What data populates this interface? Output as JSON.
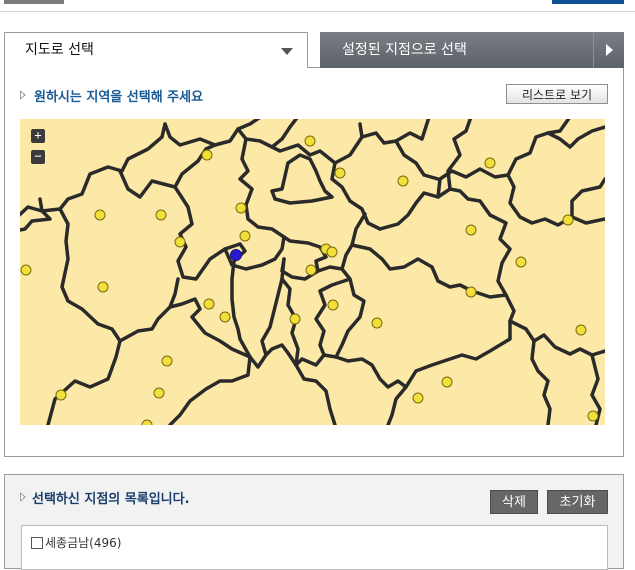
{
  "tabs": {
    "map_select": "지도로 선택",
    "preset_select": "설정된 지점으로 선택"
  },
  "instruction": "원하시는 지역을 선택해 주세요",
  "list_view_button": "리스트로 보기",
  "map_controls": {
    "zoom_in": "+",
    "zoom_out": "−"
  },
  "selected_list": {
    "title": "선택하신 지점의 목록입니다.",
    "delete_button": "삭제",
    "reset_button": "초기화",
    "items": [
      {
        "label": "세종금남(496)",
        "checked": false
      }
    ]
  },
  "colors": {
    "map_fill": "#fde9a7",
    "border": "#2a2a2a",
    "station_marker": "#f2df3a",
    "selected_marker": "#2a1bd1",
    "accent_blue": "#1a5a96"
  }
}
